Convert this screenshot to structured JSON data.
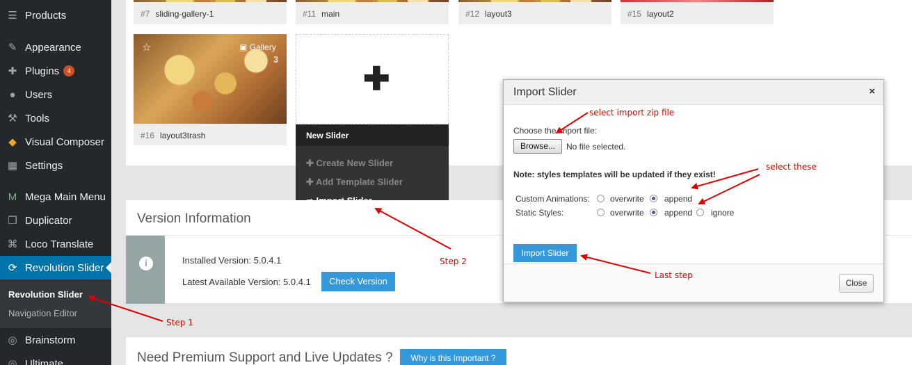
{
  "sidebar": {
    "items": [
      {
        "label": "Products",
        "icon": "products-icon"
      },
      {
        "label": "Appearance",
        "icon": "paintbrush-icon"
      },
      {
        "label": "Plugins",
        "icon": "plugin-icon",
        "badge": "4"
      },
      {
        "label": "Users",
        "icon": "user-icon"
      },
      {
        "label": "Tools",
        "icon": "wrench-icon"
      },
      {
        "label": "Visual Composer",
        "icon": "visual-composer-icon"
      },
      {
        "label": "Settings",
        "icon": "settings-icon"
      },
      {
        "label": "Mega Main Menu",
        "icon": "mega-menu-icon"
      },
      {
        "label": "Duplicator",
        "icon": "duplicator-icon"
      },
      {
        "label": "Loco Translate",
        "icon": "translate-icon"
      },
      {
        "label": "Revolution Slider",
        "icon": "refresh-icon"
      },
      {
        "label": "Brainstorm",
        "icon": "brainstorm-icon"
      },
      {
        "label": "Ultimate",
        "icon": "ultimate-icon"
      }
    ],
    "submenu": [
      "Revolution Slider",
      "Navigation Editor"
    ]
  },
  "sliders": [
    {
      "num": "#7",
      "name": "sliding-gallery-1"
    },
    {
      "num": "#11",
      "name": "main"
    },
    {
      "num": "#12",
      "name": "layout3"
    },
    {
      "num": "#15",
      "name": "layout2"
    },
    {
      "num": "#16",
      "name": "layout3trash",
      "type": "Gallery",
      "count": "3"
    }
  ],
  "new_slider": {
    "title": "New Slider",
    "items": [
      "Create New Slider",
      "Add Template Slider",
      "Import Slider"
    ]
  },
  "version": {
    "title": "Version Information",
    "installed": "Installed Version: 5.0.4.1",
    "latest": "Latest Available Version: 5.0.4.1",
    "check_button": "Check Version"
  },
  "premium": {
    "title": "Need Premium Support and Live Updates ?",
    "button": "Why is this Important ?"
  },
  "modal": {
    "title": "Import Slider",
    "close_glyph": "×",
    "choose_label": "Choose the import file:",
    "browse": "Browse...",
    "no_file": "No file selected.",
    "note": "Note: styles templates will be updated if they exist!",
    "custom_animations": "Custom Animations:",
    "static_styles": "Static Styles:",
    "overwrite": "overwrite",
    "append": "append",
    "ignore": "ignore",
    "import_button": "Import Slider",
    "close_button": "Close"
  },
  "annotations": {
    "select_zip": "select import zip file",
    "select_these": "select these",
    "last_step": "Last step",
    "step1": "Step 1",
    "step2": "Step 2"
  },
  "colors": {
    "accent": "#0073aa",
    "button_blue": "#3498db",
    "annotation": "#e00000"
  }
}
